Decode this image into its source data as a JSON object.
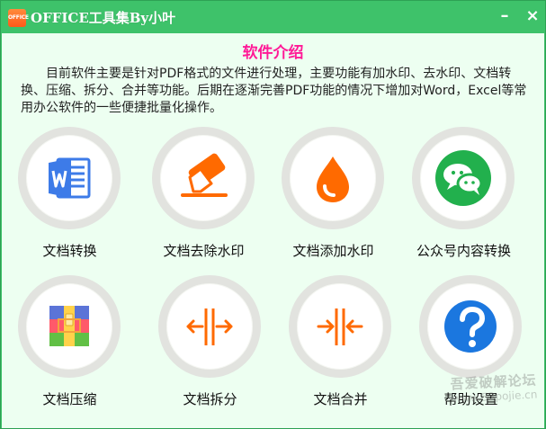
{
  "window": {
    "app_icon_text": "OFFICE",
    "title": "OFFICE工具集By小叶",
    "minimize_label": "–",
    "close_label": "×"
  },
  "intro": {
    "heading": "软件介绍",
    "text": "目前软件主要是针对PDF格式的文件进行处理，主要功能有加水印、去水印、文档转换、压缩、拆分、合并等功能。后期在逐渐完善PDF功能的情况下增加对Word，Excel等常用办公软件的一些便捷批量化操作。"
  },
  "tools": [
    {
      "label": "文档转换",
      "icon": "word-document-icon"
    },
    {
      "label": "文档去除水印",
      "icon": "eraser-icon"
    },
    {
      "label": "文档添加水印",
      "icon": "water-drop-icon"
    },
    {
      "label": "公众号内容转换",
      "icon": "wechat-icon"
    },
    {
      "label": "文档压缩",
      "icon": "archive-icon"
    },
    {
      "label": "文档拆分",
      "icon": "split-icon"
    },
    {
      "label": "文档合并",
      "icon": "merge-icon"
    },
    {
      "label": "帮助设置",
      "icon": "help-question-icon"
    }
  ],
  "watermark": {
    "line1": "吾爱破解论坛",
    "line2": "www.52pojie.cn"
  },
  "colors": {
    "titlebar": "#3ec26a",
    "content_background": "#edfff1",
    "heading": "#ff1a97",
    "orange_icons": "#ff6a00",
    "word_blue": "#3d7be8",
    "wechat_green": "#22b04d",
    "help_blue": "#1b77df"
  }
}
